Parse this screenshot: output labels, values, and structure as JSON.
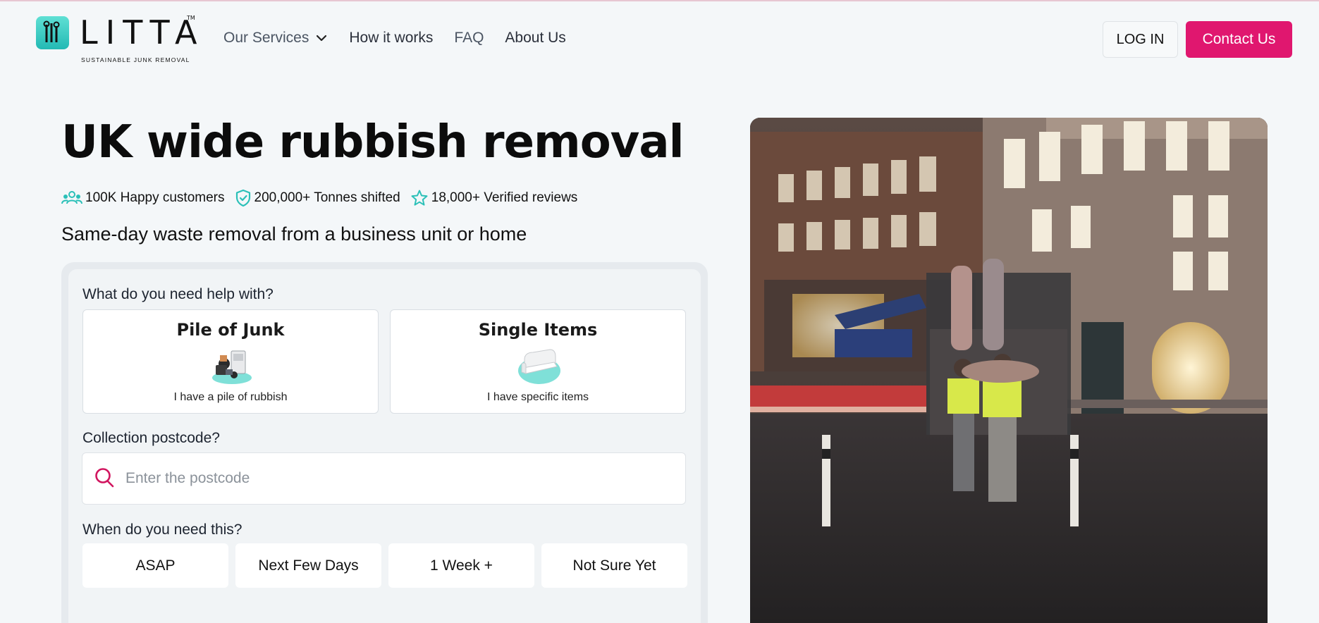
{
  "brand": {
    "name": "LITTA",
    "trademark": "TM",
    "tagline": "SUSTAINABLE JUNK REMOVAL",
    "accent_color": "#e0176f",
    "teal_color": "#2bc0b8"
  },
  "nav": {
    "items": [
      {
        "label": "Our Services",
        "icon": "chevron-down-icon"
      },
      {
        "label": "How it works"
      },
      {
        "label": "FAQ"
      },
      {
        "label": "About Us"
      }
    ],
    "login_label": "LOG IN",
    "contact_label": "Contact Us"
  },
  "hero": {
    "title": "UK wide rubbish removal",
    "stats": [
      {
        "icon": "users-icon",
        "text": "100K Happy customers"
      },
      {
        "icon": "shield-check-icon",
        "text": "200,000+ Tonnes shifted"
      },
      {
        "icon": "star-icon",
        "text": "18,000+ Verified reviews"
      }
    ],
    "subtitle": "Same-day waste removal from a business unit or home"
  },
  "form": {
    "help_question": "What do you need help with?",
    "choices": [
      {
        "title": "Pile of Junk",
        "subtitle": "I have a pile of rubbish",
        "icon": "junk-pile-illustration"
      },
      {
        "title": "Single Items",
        "subtitle": "I have specific items",
        "icon": "sofa-illustration"
      }
    ],
    "postcode_question": "Collection postcode?",
    "postcode_placeholder": "Enter the postcode",
    "postcode_value": "",
    "time_question": "When do you need this?",
    "time_options": [
      "ASAP",
      "Next Few Days",
      "1 Week +",
      "Not Sure Yet"
    ]
  },
  "photo": {
    "subject": "night-street-workers-loading-truck"
  }
}
